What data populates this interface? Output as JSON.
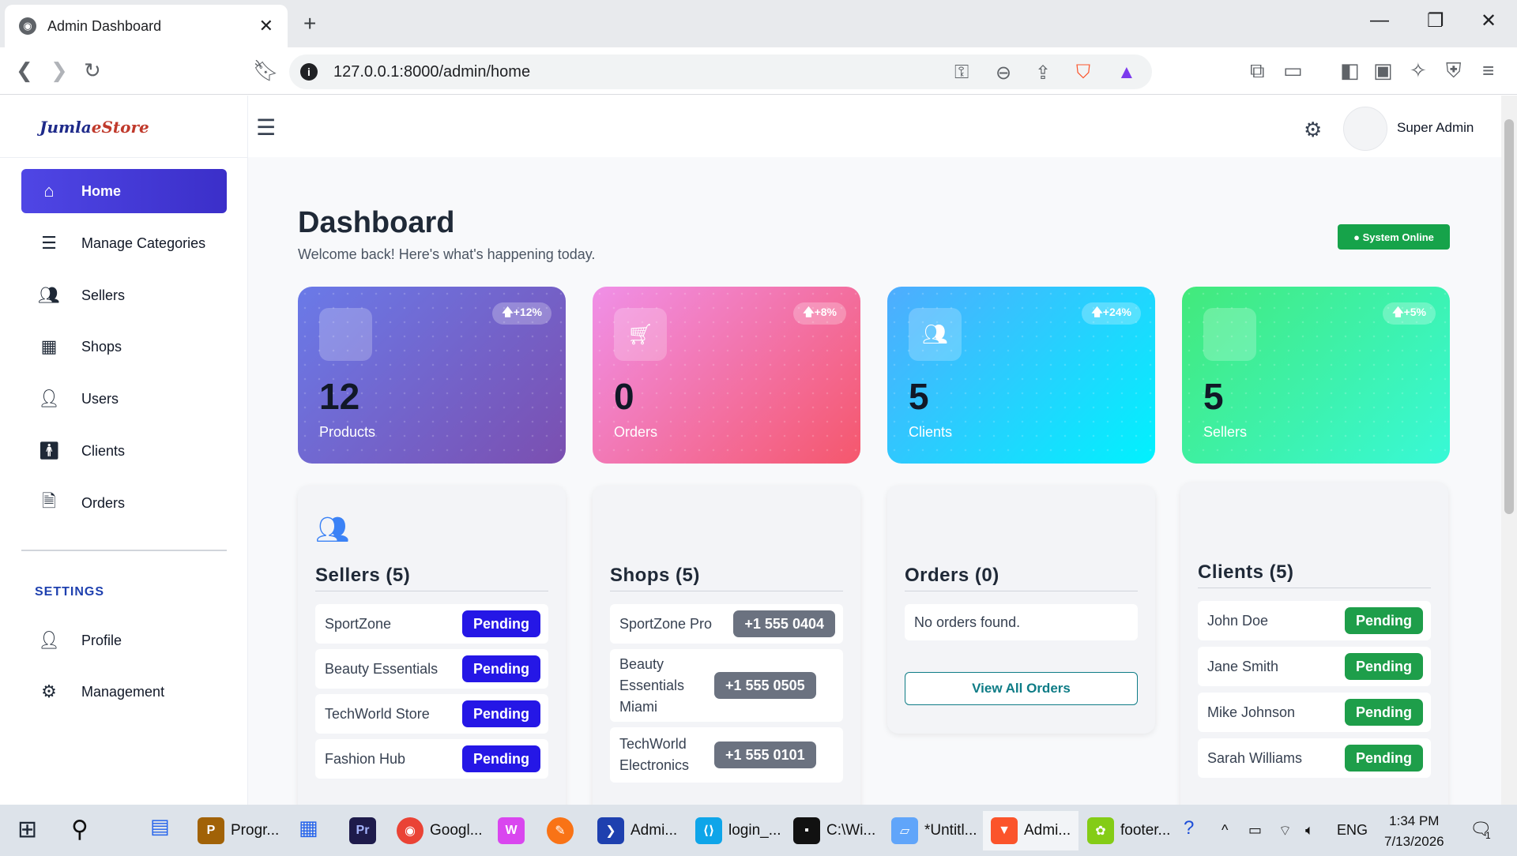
{
  "browser": {
    "tab_title": "Admin Dashboard",
    "url": "127.0.0.1:8000/admin/home"
  },
  "brand": {
    "logo_main": "Jumla",
    "logo_accent": "eStore"
  },
  "sidebar": {
    "items": [
      {
        "label": "Home",
        "icon": "home-icon",
        "active": true
      },
      {
        "label": "Manage Categories",
        "icon": "list-icon"
      },
      {
        "label": "Sellers",
        "icon": "users-icon"
      },
      {
        "label": "Shops",
        "icon": "building-icon"
      },
      {
        "label": "Users",
        "icon": "user-icon"
      },
      {
        "label": "Clients",
        "icon": "person-standing-icon"
      },
      {
        "label": "Orders",
        "icon": "file-icon"
      }
    ],
    "settings_heading": "SETTINGS",
    "settings_items": [
      {
        "label": "Profile",
        "icon": "user-icon"
      },
      {
        "label": "Management",
        "icon": "cogs-icon"
      }
    ]
  },
  "header": {
    "admin_name": "Super Admin"
  },
  "page": {
    "title": "Dashboard",
    "subtitle": "Welcome back! Here's what's happening today.",
    "status": "● System Online"
  },
  "stats": [
    {
      "value": "12",
      "label": "Products",
      "badge": "🡅+12%",
      "gradient": [
        "#6a7ae8",
        "#7b4fb0"
      ]
    },
    {
      "value": "0",
      "label": "Orders",
      "badge": "🡅+8%",
      "gradient": [
        "#f090e8",
        "#f5576c"
      ]
    },
    {
      "value": "5",
      "label": "Clients",
      "badge": "🡅+24%",
      "gradient": [
        "#4facfe",
        "#00f2fe"
      ]
    },
    {
      "value": "5",
      "label": "Sellers",
      "badge": "🡅+5%",
      "gradient": [
        "#43e97b",
        "#38f9d7"
      ]
    }
  ],
  "panels": {
    "sellers": {
      "title": "Sellers (5)",
      "rows": [
        {
          "name": "SportZone",
          "badge": "Pending"
        },
        {
          "name": "Beauty Essentials",
          "badge": "Pending"
        },
        {
          "name": "TechWorld Store",
          "badge": "Pending"
        },
        {
          "name": "Fashion Hub",
          "badge": "Pending"
        }
      ]
    },
    "shops": {
      "title": "Shops (5)",
      "rows": [
        {
          "name": "SportZone Pro",
          "phone": "+1 555 0404"
        },
        {
          "name": "Beauty Essentials Miami",
          "phone": "+1 555 0505"
        },
        {
          "name": "TechWorld Electronics",
          "phone": "+1 555 0101"
        }
      ]
    },
    "orders": {
      "title": "Orders (0)",
      "empty": "No orders found.",
      "button": "View All Orders"
    },
    "clients": {
      "title": "Clients (5)",
      "rows": [
        {
          "name": "John Doe",
          "badge": "Pending"
        },
        {
          "name": "Jane Smith",
          "badge": "Pending"
        },
        {
          "name": "Mike Johnson",
          "badge": "Pending"
        },
        {
          "name": "Sarah Williams",
          "badge": "Pending"
        }
      ]
    }
  },
  "taskbar": {
    "items": [
      {
        "label": "Progr..."
      },
      {
        "label": "Googl..."
      },
      {
        "label": "Admi..."
      },
      {
        "label": "login_..."
      },
      {
        "label": "C:\\Wi..."
      },
      {
        "label": "*Untitl..."
      },
      {
        "label": "Admi..."
      },
      {
        "label": "footer..."
      }
    ],
    "lang": "ENG",
    "time": "1:34 PM",
    "date": "7/13/2026",
    "notif_count": "1"
  }
}
